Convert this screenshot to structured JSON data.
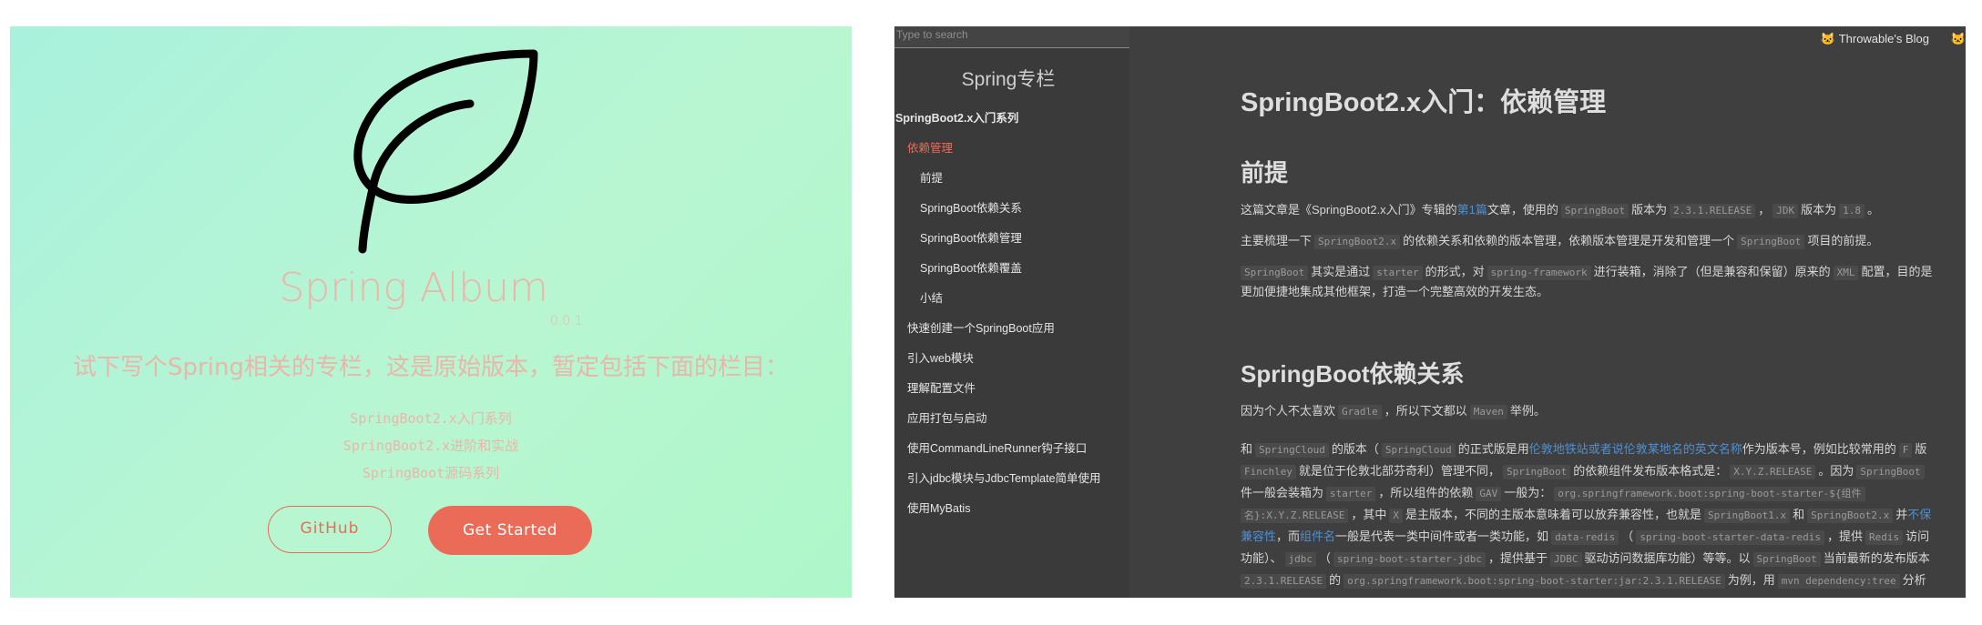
{
  "cover": {
    "title": "Spring Album",
    "version": "0.0.1",
    "description": "试下写个Spring相关的专栏，这是原始版本，暂定包括下面的栏目：",
    "topics": [
      "SpringBoot2.x入门系列",
      "SpringBoot2.x进阶和实战",
      "SpringBoot源码系列"
    ],
    "github_label": "GitHub",
    "start_label": "Get Started",
    "colors": {
      "accent": "#e96b58",
      "bg_from": "#a9f1dd",
      "bg_to": "#aef7c9",
      "text": "#ebb6aa"
    }
  },
  "docs": {
    "search_placeholder": "Type to search",
    "sidebar_title": "Spring专栏",
    "nav": [
      {
        "label": "SpringBoot2.x入门系列",
        "level": 0,
        "active": false
      },
      {
        "label": "依赖管理",
        "level": 1,
        "active": true
      },
      {
        "label": "前提",
        "level": 2,
        "active": false
      },
      {
        "label": "SpringBoot依赖关系",
        "level": 2,
        "active": false
      },
      {
        "label": "SpringBoot依赖管理",
        "level": 2,
        "active": false
      },
      {
        "label": "SpringBoot依赖覆盖",
        "level": 2,
        "active": false
      },
      {
        "label": "小结",
        "level": 2,
        "active": false
      },
      {
        "label": "快速创建一个SpringBoot应用",
        "level": 1,
        "active": false
      },
      {
        "label": "引入web模块",
        "level": 1,
        "active": false
      },
      {
        "label": "理解配置文件",
        "level": 1,
        "active": false
      },
      {
        "label": "应用打包与启动",
        "level": 1,
        "active": false
      },
      {
        "label": "使用CommandLineRunner钩子接口",
        "level": 1,
        "active": false
      },
      {
        "label": "引入jdbc模块与JdbcTemplate简单使用",
        "level": 1,
        "active": false
      },
      {
        "label": "使用MyBatis",
        "level": 1,
        "active": false
      }
    ],
    "topnav": {
      "blog_label": "Throwable's Blog",
      "blog_icon": "cat-face-icon"
    },
    "article": {
      "title": "SpringBoot2.x入门：依赖管理",
      "h_premise": "前提",
      "p1": {
        "a": "这篇文章是《SpringBoot2.x入门》专辑的",
        "link": "第1篇",
        "b": "文章，使用的",
        "c1": "SpringBoot",
        "d": "版本为",
        "c2": "2.3.1.RELEASE",
        "e": "，",
        "c3": "JDK",
        "f": "版本为",
        "c4": "1.8",
        "g": "。"
      },
      "p2": {
        "a": "主要梳理一下",
        "c1": "SpringBoot2.x",
        "b": "的依赖关系和依赖的版本管理，依赖版本管理是开发和管理一个",
        "c2": "SpringBoot",
        "c": "项目的前提。"
      },
      "p3": {
        "c1": "SpringBoot",
        "a": "其实是通过",
        "c2": "starter",
        "b": "的形式，对",
        "c3": "spring-framework",
        "c": "进行装箱，消除了（但是兼容和保留）原来的",
        "c4": "XML",
        "d": "配置，目的是",
        "line2": "更加便捷地集成其他框架，打造一个完整高效的开发生态。"
      },
      "h_relation": "SpringBoot依赖关系",
      "p4": {
        "a": "因为个人不太喜欢",
        "c1": "Gradle",
        "b": "，所以下文都以",
        "c2": "Maven",
        "c": "举例。"
      },
      "p5": {
        "l1a": "和",
        "l1c1": "SpringCloud",
        "l1b": "的版本（",
        "l1c2": "SpringCloud",
        "l1c": "的正式版是用",
        "l1link": "伦敦地铁站或者说伦敦某地名的英文名称",
        "l1d": "作为版本号，例如比较常用的",
        "l1c3": "F",
        "l1e": "版",
        "l2c1": "Finchley",
        "l2a": "就是位于伦敦北部芬奇利）管理不同，",
        "l2c2": "SpringBoot",
        "l2b": "的依赖组件发布版本格式是：",
        "l2c3": "X.Y.Z.RELEASE",
        "l2c": "。因为",
        "l2c4": "SpringBoot",
        "l3a": "件一般会装箱为",
        "l3c1": "starter",
        "l3b": "，所以组件的依赖",
        "l3c2": "GAV",
        "l3c": "一般为：",
        "l3c3": "org.springframework.boot:spring-boot-starter-${组件",
        "l4c1": "名}:X.Y.Z.RELEASE",
        "l4a": "，其中",
        "l4c2": "X",
        "l4b": "是主版本，不同的主版本意味着可以放弃兼容性，也就是",
        "l4c3": "SpringBoot1.x",
        "l4c": "和",
        "l4c4": "SpringBoot2.x",
        "l4d": "并",
        "l4link": "不保",
        "l5link1": "兼容性",
        "l5a": "，而",
        "l5link2": "组件名",
        "l5b": "一般是代表一类中间件或者一类功能，如",
        "l5c1": "data-redis",
        "l5c": "（",
        "l5c2": "spring-boot-starter-data-redis",
        "l5d": "，提供",
        "l5c3": "Redis",
        "l5e": "访问",
        "l6a": "功能）、",
        "l6c1": "jdbc",
        "l6b": "（",
        "l6c2": "spring-boot-starter-jdbc",
        "l6c": "，提供基于",
        "l6c3": "JDBC",
        "l6d": "驱动访问数据库功能）等等。以",
        "l6c4": "SpringBoot",
        "l6e": "当前最新的发布版本",
        "l7c1": "2.3.1.RELEASE",
        "l7a": "的",
        "l7c2": "org.springframework.boot:spring-boot-starter:jar:2.3.1.RELEASE",
        "l7b": "为例，用",
        "l7c3": "mvn dependency:tree",
        "l7c": "分析"
      }
    }
  }
}
